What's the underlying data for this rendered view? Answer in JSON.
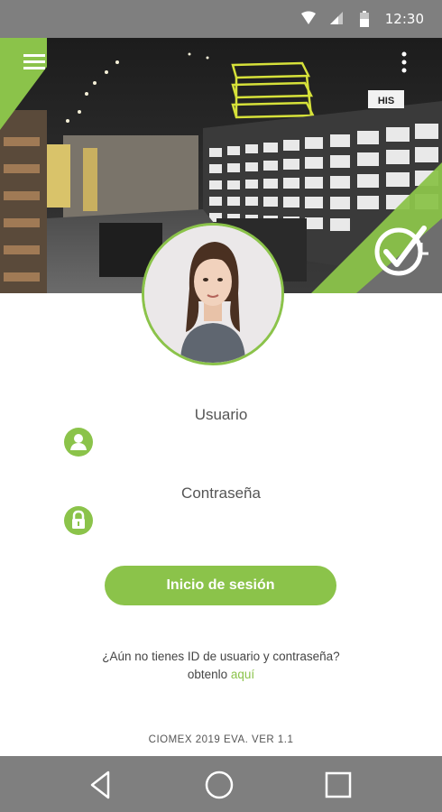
{
  "status_bar": {
    "time": "12:30",
    "icons": [
      "wifi-icon",
      "signal-icon",
      "battery-icon"
    ]
  },
  "header": {
    "menu_icon": "hamburger-menu-icon",
    "more_icon": "more-vertical-icon",
    "logo_icon": "checkmark-logo-icon",
    "store_sign": "HIS"
  },
  "login": {
    "username_label": "Usuario",
    "username_icon": "user-icon",
    "username_value": "",
    "password_label": "Contraseña",
    "password_icon": "lock-icon",
    "password_value": "",
    "submit_label": "Inicio de sesión"
  },
  "help": {
    "question": "¿Aún no tienes ID de usuario y contraseña?",
    "prefix": "obtenlo",
    "link": "aquí"
  },
  "footer": {
    "version": "CIOMEX 2019 EVA. VER 1.1"
  },
  "colors": {
    "accent": "#8bc34a",
    "system_bar": "#7f7f7f",
    "text": "#555555"
  },
  "nav_bar": {
    "buttons": [
      "back-icon",
      "home-icon",
      "recents-icon"
    ]
  }
}
